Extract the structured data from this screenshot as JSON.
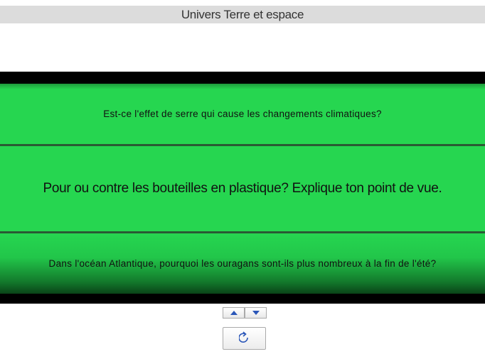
{
  "header": {
    "title": "Univers Terre et espace"
  },
  "cards": [
    {
      "text": "Est-ce l'effet de serre qui cause les changements climatiques?"
    },
    {
      "text": "Pour ou contre les bouteilles en plastique? Explique ton point de vue."
    },
    {
      "text": "Dans l'océan Atlantique, pourquoi les ouragans sont-ils plus nombreux à la fin de l'été?"
    }
  ],
  "controls": {
    "up_icon": "triangle-up-icon",
    "down_icon": "triangle-down-icon",
    "refresh_icon": "refresh-icon"
  },
  "colors": {
    "card_green": "#26d650",
    "frame_black": "#000000",
    "header_gray": "#dcdcdc",
    "icon_blue": "#2a56b8"
  }
}
